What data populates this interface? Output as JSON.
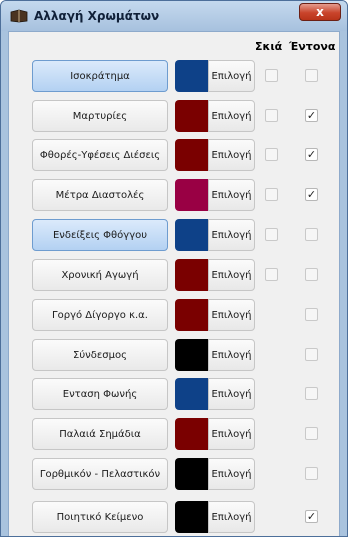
{
  "window": {
    "title": "Αλλαγή Χρωμάτων",
    "close_symbol": "x",
    "title_icon": "book-icon"
  },
  "headers": {
    "shade": "Σκιά",
    "bold": "Έντονα"
  },
  "choose_label": "Επιλογή",
  "rows": [
    {
      "label": "Ισοκράτημα",
      "color": "#0e4188",
      "active": true,
      "shade_enabled": true,
      "shade_checked": false,
      "bold_checked": false
    },
    {
      "label": "Μαρτυρίες",
      "color": "#7a0000",
      "active": false,
      "shade_enabled": true,
      "shade_checked": false,
      "bold_checked": true
    },
    {
      "label": "Φθορές-Υφέσεις Διέσεις",
      "color": "#7a0000",
      "active": false,
      "shade_enabled": true,
      "shade_checked": false,
      "bold_checked": true
    },
    {
      "label": "Μέτρα Διαστολές",
      "color": "#990044",
      "active": false,
      "shade_enabled": true,
      "shade_checked": false,
      "bold_checked": true
    },
    {
      "label": "Ενδείξεις Φθόγγου",
      "color": "#0e4188",
      "active": true,
      "shade_enabled": true,
      "shade_checked": false,
      "bold_checked": false
    },
    {
      "label": "Χρονική Αγωγή",
      "color": "#7a0000",
      "active": false,
      "shade_enabled": true,
      "shade_checked": false,
      "bold_checked": false
    },
    {
      "label": "Γοργό Δίγοργο κ.α.",
      "color": "#7a0000",
      "active": false,
      "shade_enabled": false,
      "shade_checked": false,
      "bold_checked": false
    },
    {
      "label": "Σύνδεσμος",
      "color": "#000000",
      "active": false,
      "shade_enabled": false,
      "shade_checked": false,
      "bold_checked": false
    },
    {
      "label": "Ενταση Φωνής",
      "color": "#0e4188",
      "active": false,
      "shade_enabled": false,
      "shade_checked": false,
      "bold_checked": false
    },
    {
      "label": "Παλαιά Σημάδια",
      "color": "#7a0000",
      "active": false,
      "shade_enabled": false,
      "shade_checked": false,
      "bold_checked": false
    },
    {
      "label": "Γορθμικόν - Πελαστικόν",
      "color": "#000000",
      "active": false,
      "shade_enabled": false,
      "shade_checked": false,
      "bold_checked": false
    },
    {
      "label": "Ποιητικό Κείμενο",
      "color": "#000000",
      "active": false,
      "shade_enabled": false,
      "shade_checked": false,
      "bold_checked": true
    }
  ]
}
